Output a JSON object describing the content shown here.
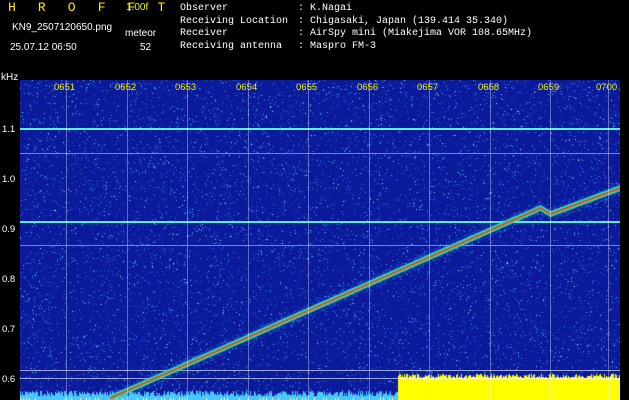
{
  "header": {
    "logo": "H R O F F T",
    "version": "1.00f",
    "filename": "KN9_2507120650.png",
    "meteor_label": "meteor",
    "timestamp": "25.07.12 06:50",
    "meteor_count": "52",
    "observer_label": "Observer",
    "observer_value": ": K.Nagai",
    "location_label": "Receiving Location",
    "location_value": ": Chigasaki, Japan (139.414 35.340)",
    "receiver_label": "Receiver",
    "receiver_value": ": AirSpy mini (Miakejima VOR 108.65MHz)",
    "antenna_label": "Receiving antenna",
    "antenna_value": ": Maspro FM-3"
  },
  "plot": {
    "y_unit": "kHz",
    "y_labels": [
      "1.1",
      "1.0",
      "0.9",
      "0.8",
      "0.7",
      "0.6"
    ],
    "x_labels": [
      "0651",
      "0652",
      "0653",
      "0654",
      "0655",
      "0656",
      "0657",
      "0658",
      "0659",
      "0700"
    ],
    "background_color": "#0a1a9a",
    "trace_color": "#e8402a",
    "line_color": "#40e0d0",
    "baseline_color": "#ffff00"
  }
}
